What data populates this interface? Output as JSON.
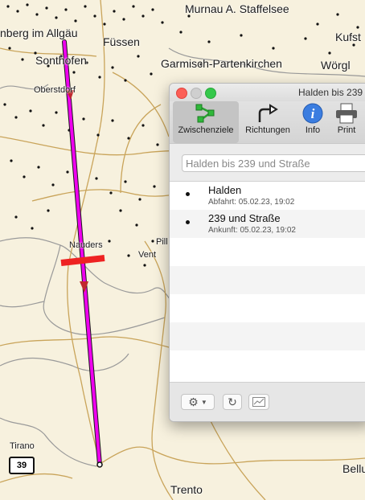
{
  "map": {
    "places": [
      {
        "id": "murnau",
        "label": "Murnau A. Staffelsee"
      },
      {
        "id": "kufstein",
        "label": "Kufst"
      },
      {
        "id": "kempten",
        "label": "nberg im Allgäu"
      },
      {
        "id": "fussen",
        "label": "Füssen"
      },
      {
        "id": "sonthofen",
        "label": "Sonthofen"
      },
      {
        "id": "garmisch",
        "label": "Garmisch-Partenkirchen"
      },
      {
        "id": "worgl",
        "label": "Wörgl"
      },
      {
        "id": "oberstdorf",
        "label": "Oberstdorf"
      },
      {
        "id": "nauders",
        "label": "Nauders"
      },
      {
        "id": "vent",
        "label": "Vent"
      },
      {
        "id": "pill",
        "label": "Pill"
      },
      {
        "id": "tirano",
        "label": "Tirano"
      },
      {
        "id": "trento",
        "label": "Trento"
      },
      {
        "id": "belluno",
        "label": "Bellu"
      }
    ],
    "road_shield": "39",
    "colors": {
      "route": "#ee00ee",
      "border_cut": "#ee2222",
      "land": "#f7f1de",
      "roads": "#c9a45a",
      "borders": "#9a9a9a"
    }
  },
  "window": {
    "title": "Halden bis 239",
    "toolbar": [
      {
        "id": "waypoints",
        "label": "Zwischenziele",
        "icon": "waypoints-icon",
        "selected": true
      },
      {
        "id": "directions",
        "label": "Richtungen",
        "icon": "turn-arrow-icon",
        "selected": false
      },
      {
        "id": "info",
        "label": "Info",
        "icon": "info-icon",
        "selected": false
      },
      {
        "id": "print",
        "label": "Print",
        "icon": "printer-icon",
        "selected": false
      }
    ],
    "search_placeholder": "Halden bis 239 und Straße",
    "waypoints": [
      {
        "name": "Halden",
        "detail": "Abfahrt: 05.02.23, 19:02"
      },
      {
        "name": "239 und Straße",
        "detail": "Ankunft: 05.02.23, 19:02"
      }
    ],
    "bottom_buttons": [
      {
        "id": "settings",
        "icon": "gear-icon"
      },
      {
        "id": "refresh",
        "icon": "refresh-icon"
      },
      {
        "id": "profile",
        "icon": "elevation-profile-icon"
      }
    ]
  }
}
